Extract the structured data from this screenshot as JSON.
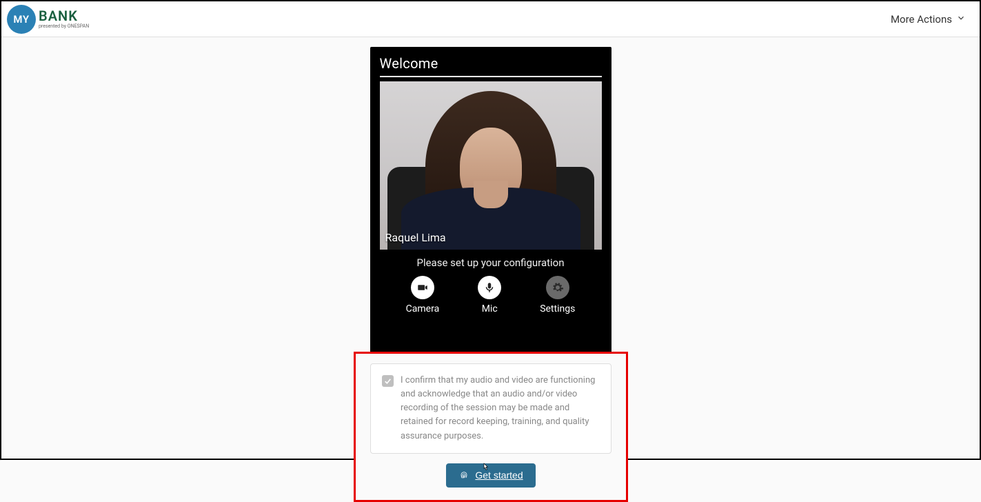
{
  "header": {
    "logo_circle_text": "MY",
    "logo_text": "BANK",
    "logo_subtitle": "presented by ONESPAN",
    "more_actions_label": "More Actions"
  },
  "widget": {
    "title": "Welcome",
    "participant_name": "Raquel Lima",
    "config_prompt": "Please set up your configuration",
    "controls": {
      "camera_label": "Camera",
      "mic_label": "Mic",
      "settings_label": "Settings"
    }
  },
  "consent": {
    "text": "I confirm that my audio and video are functioning and acknowledge that an audio and/or video recording of the session may be made and retained for record keeping, training, and quality assurance purposes."
  },
  "cta": {
    "get_started_label": "Get started"
  }
}
